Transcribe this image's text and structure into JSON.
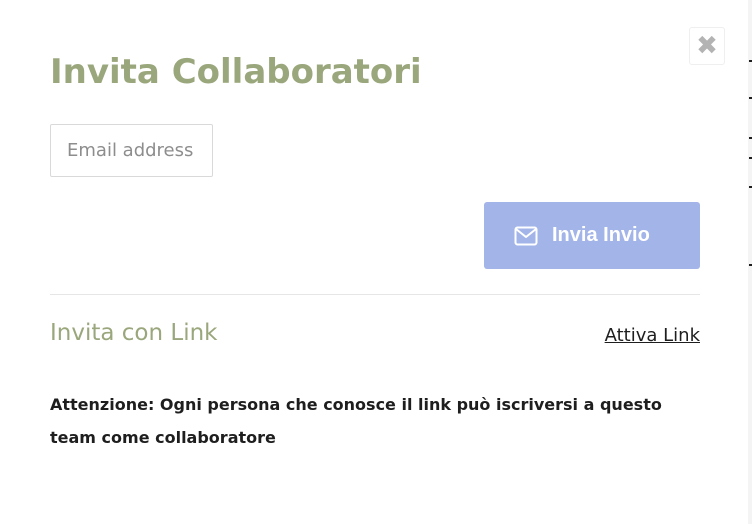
{
  "modal": {
    "title": "Invita Collaboratori",
    "close_glyph": "✖",
    "close_icon": "close-icon"
  },
  "invite_form": {
    "email_placeholder": "Email address",
    "email_value": "",
    "send_button_label": "Invia Invio",
    "send_button_icon": "envelope-icon",
    "send_button_color": "#a3b4e9"
  },
  "link_section": {
    "heading": "Invita con Link",
    "activate_label": "Attiva Link",
    "warning": "Attenzione: Ogni persona che conosce il link può iscriversi a questo team come collaboratore"
  },
  "colors": {
    "title": "#9aa77c",
    "text": "#1e1e1e",
    "divider": "#e6e6e6"
  }
}
